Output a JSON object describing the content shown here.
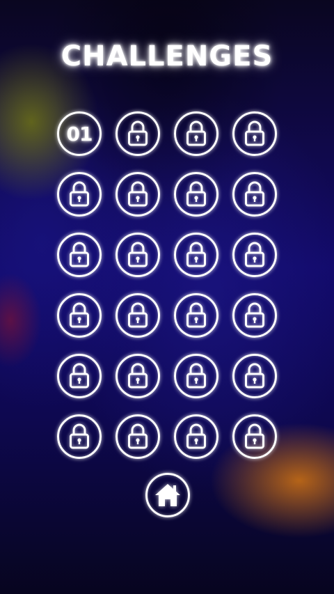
{
  "title": "CHALLENGES",
  "levels": [
    {
      "label": "01",
      "locked": false
    },
    {
      "label": "",
      "locked": true,
      "icon": "lock-icon"
    },
    {
      "label": "",
      "locked": true,
      "icon": "lock-icon"
    },
    {
      "label": "",
      "locked": true,
      "icon": "lock-icon"
    },
    {
      "label": "",
      "locked": true,
      "icon": "lock-icon"
    },
    {
      "label": "",
      "locked": true,
      "icon": "lock-icon"
    },
    {
      "label": "",
      "locked": true,
      "icon": "lock-icon"
    },
    {
      "label": "",
      "locked": true,
      "icon": "lock-icon"
    },
    {
      "label": "",
      "locked": true,
      "icon": "lock-icon"
    },
    {
      "label": "",
      "locked": true,
      "icon": "lock-icon"
    },
    {
      "label": "",
      "locked": true,
      "icon": "lock-icon"
    },
    {
      "label": "",
      "locked": true,
      "icon": "lock-icon"
    },
    {
      "label": "",
      "locked": true,
      "icon": "lock-icon"
    },
    {
      "label": "",
      "locked": true,
      "icon": "lock-icon"
    },
    {
      "label": "",
      "locked": true,
      "icon": "lock-icon"
    },
    {
      "label": "",
      "locked": true,
      "icon": "lock-icon"
    },
    {
      "label": "",
      "locked": true,
      "icon": "lock-icon"
    },
    {
      "label": "",
      "locked": true,
      "icon": "lock-icon"
    },
    {
      "label": "",
      "locked": true,
      "icon": "lock-icon"
    },
    {
      "label": "",
      "locked": true,
      "icon": "lock-icon"
    },
    {
      "label": "",
      "locked": true,
      "icon": "lock-icon"
    },
    {
      "label": "",
      "locked": true,
      "icon": "lock-icon"
    },
    {
      "label": "",
      "locked": true,
      "icon": "lock-icon"
    },
    {
      "label": "",
      "locked": true,
      "icon": "lock-icon"
    }
  ],
  "home_button": {
    "icon": "home-icon"
  },
  "colors": {
    "glow": "#ffffff",
    "background_top": "#0a0620",
    "background_mid": "#120a6a",
    "accent_yellow": "#6e7314",
    "accent_orange": "#c86e14"
  }
}
